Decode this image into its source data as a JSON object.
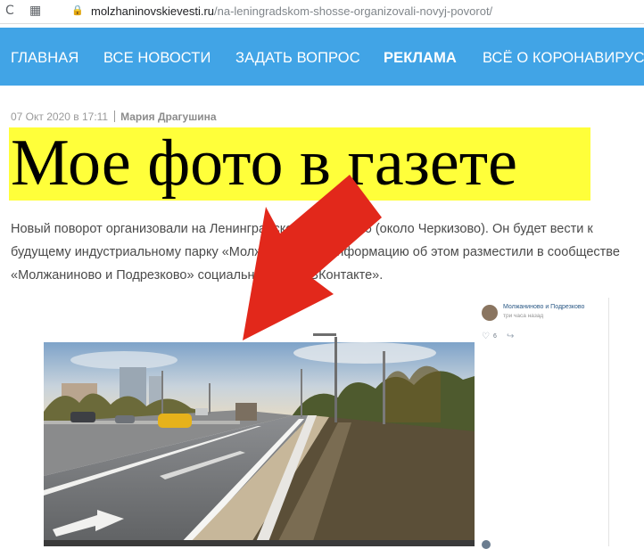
{
  "browser": {
    "url_host": "molzhaninovskievesti.ru",
    "url_path": "/na-leningradskom-shosse-organizovali-novyj-povorot/",
    "reload_glyph": "C",
    "apps_glyph": "▦",
    "lock_glyph": "🔒"
  },
  "nav": {
    "items": [
      "ГЛАВНАЯ",
      "ВСЕ НОВОСТИ",
      "ЗАДАТЬ ВОПРОС",
      "РЕКЛАМА",
      "ВСЁ О КОРОНАВИРУСЕ"
    ],
    "bg_color": "#41a4e6"
  },
  "article": {
    "date": "07 Окт 2020 в 17:11",
    "author": "Мария Драгушина",
    "headline": "Мое фото в газете",
    "headline_highlight": "#ffff3a",
    "lead": "Новый поворот организовали на Ленинградском шоссе, 346 (около Черкизово). Он будет вести к будущему индустриальному парку «Молжаниново». Информацию об этом разместили в сообществе «Молжаниново и Подрезково» социальной сети «ВКонтакте»."
  },
  "vk_post": {
    "group_name": "Молжаниново и Подрезково",
    "time": "три часа назад",
    "likes": "6",
    "heart_icon": "♡",
    "share_icon": "↪"
  },
  "annotation": {
    "arrow_color": "#e2281b"
  }
}
